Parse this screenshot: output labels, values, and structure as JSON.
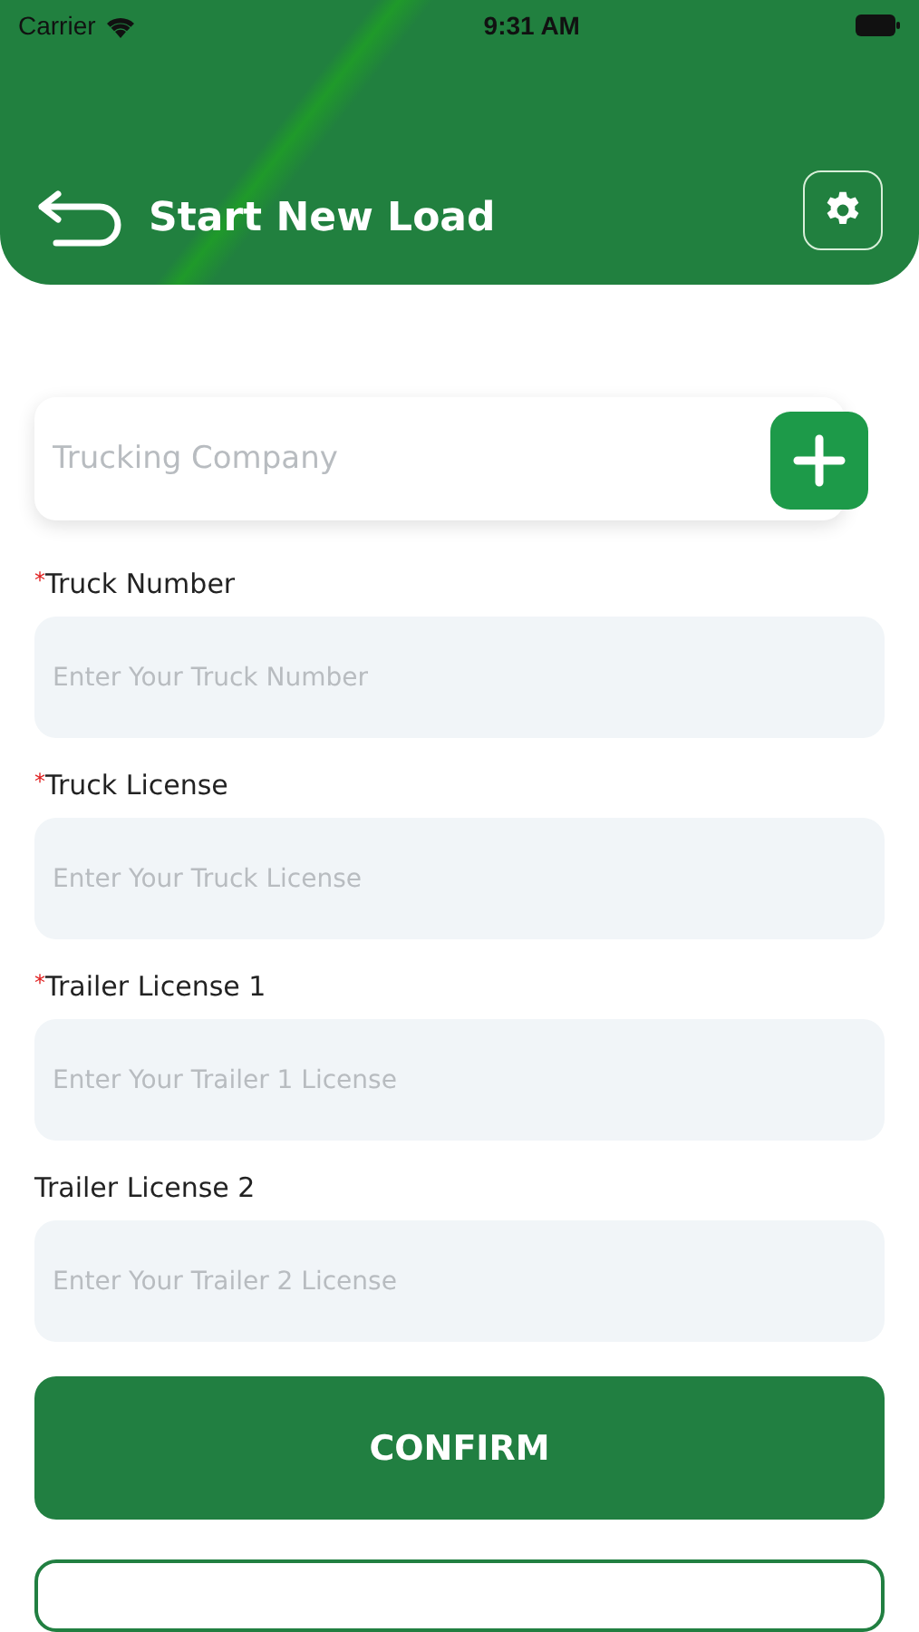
{
  "status_bar": {
    "carrier": "Carrier",
    "time": "9:31 AM"
  },
  "header": {
    "title": "Start New Load"
  },
  "company": {
    "placeholder": "Trucking Company"
  },
  "fields": [
    {
      "mark": "*",
      "label": "Truck Number",
      "placeholder": "Enter Your Truck Number"
    },
    {
      "mark": "*",
      "label": "Truck License",
      "placeholder": "Enter Your Truck License"
    },
    {
      "mark": "*",
      "label": "Trailer License 1",
      "placeholder": "Enter Your Trailer 1 License"
    },
    {
      "label": "Trailer License 2",
      "placeholder": "Enter Your Trailer 2 License"
    }
  ],
  "confirm": {
    "label": "CONFIRM"
  }
}
